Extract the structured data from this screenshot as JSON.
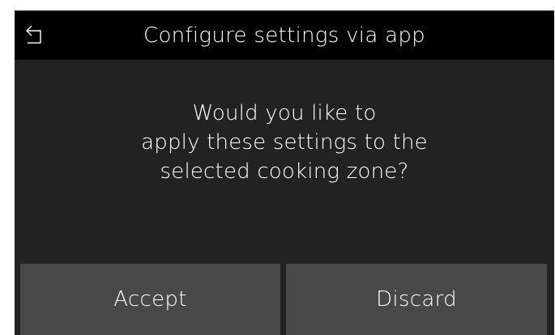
{
  "header": {
    "back_icon": "back-arrow-icon",
    "title": "Configure settings via app"
  },
  "dialog": {
    "message_lines": [
      "Would you like to",
      "apply these settings to the",
      "selected cooking zone?"
    ]
  },
  "actions": {
    "accept_label": "Accept",
    "discard_label": "Discard"
  },
  "colors": {
    "header_bg": "#000000",
    "content_bg": "#222222",
    "button_bg": "#484848",
    "text": "#ffffff"
  }
}
